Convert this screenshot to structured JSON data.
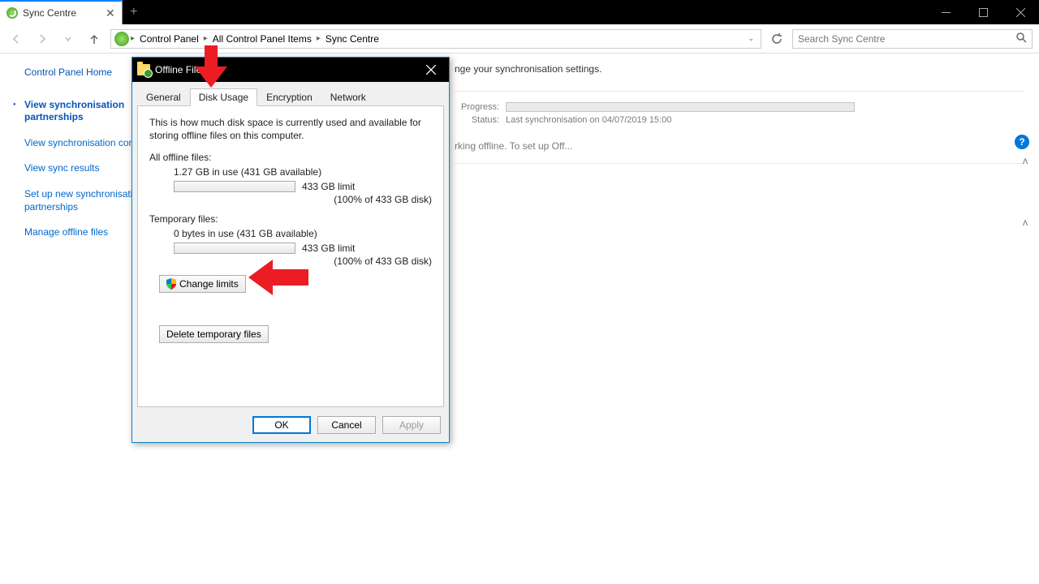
{
  "window": {
    "tab_title": "Sync Centre",
    "new_tab": "+"
  },
  "address": {
    "segments": [
      "Control Panel",
      "All Control Panel Items",
      "Sync Centre"
    ],
    "search_placeholder": "Search Sync Centre"
  },
  "sidebar": {
    "home": "Control Panel Home",
    "links": [
      "View synchronisation partnerships",
      "View synchronisation conflicts",
      "View sync results",
      "Set up new synchronisation partnerships",
      "Manage offline files"
    ]
  },
  "content": {
    "desc_suffix": "nge your synchronisation settings.",
    "progress_label": "Progress:",
    "status_label": "Status:",
    "status_value": "Last synchronisation on 04/07/2019 15:00",
    "offline_row": "rking offline. To set up Off..."
  },
  "dialog": {
    "title": "Offline Files",
    "tabs": [
      "General",
      "Disk Usage",
      "Encryption",
      "Network"
    ],
    "active_tab": 1,
    "intro": "This is how much disk space is currently used and available for storing offline files on this computer.",
    "all_files_label": "All offline files:",
    "all_files_usage": "1.27 GB in use (431 GB available)",
    "all_files_limit": "433 GB limit",
    "all_files_pct": "(100% of 433 GB disk)",
    "temp_label": "Temporary files:",
    "temp_usage": "0 bytes in use (431 GB available)",
    "temp_limit": "433 GB limit",
    "temp_pct": "(100% of 433 GB disk)",
    "change_limits": "Change limits",
    "delete_temp": "Delete temporary files",
    "ok": "OK",
    "cancel": "Cancel",
    "apply": "Apply"
  }
}
